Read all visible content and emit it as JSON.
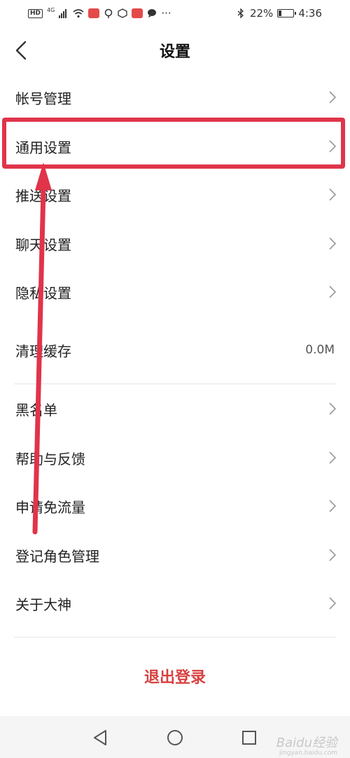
{
  "status_bar": {
    "hd": "HD",
    "network": "4G",
    "dots": "···",
    "battery_percent": "22%",
    "battery_level": 0.22,
    "time": "4:36"
  },
  "header": {
    "title": "设置"
  },
  "menu": {
    "items": [
      {
        "label": "帐号管理"
      },
      {
        "label": "通用设置"
      },
      {
        "label": "推送设置"
      },
      {
        "label": "聊天设置"
      },
      {
        "label": "隐私设置"
      },
      {
        "label": "清理缓存",
        "value": "0.0M"
      },
      {
        "label": "黑名单"
      },
      {
        "label": "帮助与反馈"
      },
      {
        "label": "申请免流量"
      },
      {
        "label": "登记角色管理"
      },
      {
        "label": "关于大神"
      }
    ]
  },
  "logout_label": "退出登录",
  "watermark": {
    "brand": "Baidu经验",
    "url": "jingyan.baidu.com"
  },
  "colors": {
    "accent_red": "#e0344a",
    "logout_red": "#d84040"
  }
}
